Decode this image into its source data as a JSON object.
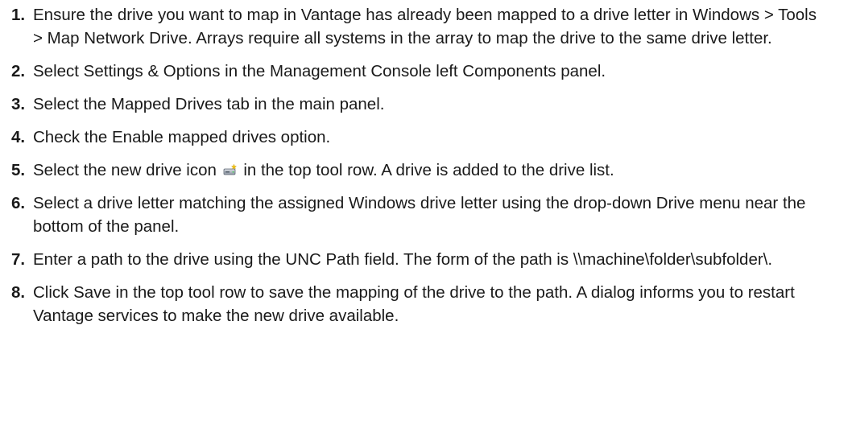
{
  "steps": [
    {
      "number": "1.",
      "text": "Ensure the drive you want to map in Vantage has already been mapped to a drive letter in Windows > Tools > Map Network Drive. Arrays require all systems in the array to map the drive to the same drive letter."
    },
    {
      "number": "2.",
      "text": "Select Settings & Options in the Management Console left Components panel."
    },
    {
      "number": "3.",
      "text": "Select the Mapped Drives tab in the main panel."
    },
    {
      "number": "4.",
      "text": "Check the Enable mapped drives option."
    },
    {
      "number": "5.",
      "text_before": "Select the new drive icon",
      "icon": "new-drive-icon",
      "text_after": "in the top tool row. A drive is added to the drive list."
    },
    {
      "number": "6.",
      "text": "Select a drive letter matching the assigned Windows drive letter using the drop-down Drive menu near the bottom of the panel."
    },
    {
      "number": "7.",
      "text": "Enter a path to the drive using the UNC Path field. The form of the path is \\\\machine\\folder\\subfolder\\."
    },
    {
      "number": "8.",
      "text": "Click Save in the top tool row to save the mapping of the drive to the path. A dialog informs you to restart Vantage services to make the new drive available."
    }
  ]
}
